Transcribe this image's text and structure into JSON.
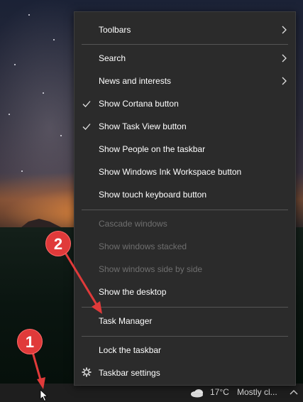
{
  "context_menu": {
    "items": [
      {
        "label": "Toolbars",
        "submenu": true
      },
      {
        "label": "Search",
        "submenu": true
      },
      {
        "label": "News and interests",
        "submenu": true
      },
      {
        "label": "Show Cortana button",
        "checked": true
      },
      {
        "label": "Show Task View button",
        "checked": true
      },
      {
        "label": "Show People on the taskbar"
      },
      {
        "label": "Show Windows Ink Workspace button"
      },
      {
        "label": "Show touch keyboard button"
      },
      {
        "label": "Cascade windows",
        "disabled": true
      },
      {
        "label": "Show windows stacked",
        "disabled": true
      },
      {
        "label": "Show windows side by side",
        "disabled": true
      },
      {
        "label": "Show the desktop"
      },
      {
        "label": "Task Manager"
      },
      {
        "label": "Lock the taskbar"
      },
      {
        "label": "Taskbar settings",
        "icon": "gear-icon"
      }
    ]
  },
  "taskbar": {
    "weather_temp": "17°C",
    "weather_desc": "Mostly cl...",
    "weather_icon": "cloud-icon",
    "tray_icon": "chevron-up-icon"
  },
  "annotations": {
    "badge1": "1",
    "badge2": "2",
    "color": "#e03a3a"
  },
  "colors": {
    "menu_bg": "#2b2b2b",
    "menu_text": "#ffffff",
    "disabled_text": "#6f6f6f",
    "separator": "#555555",
    "taskbar_bg": "#1e1e1e"
  }
}
